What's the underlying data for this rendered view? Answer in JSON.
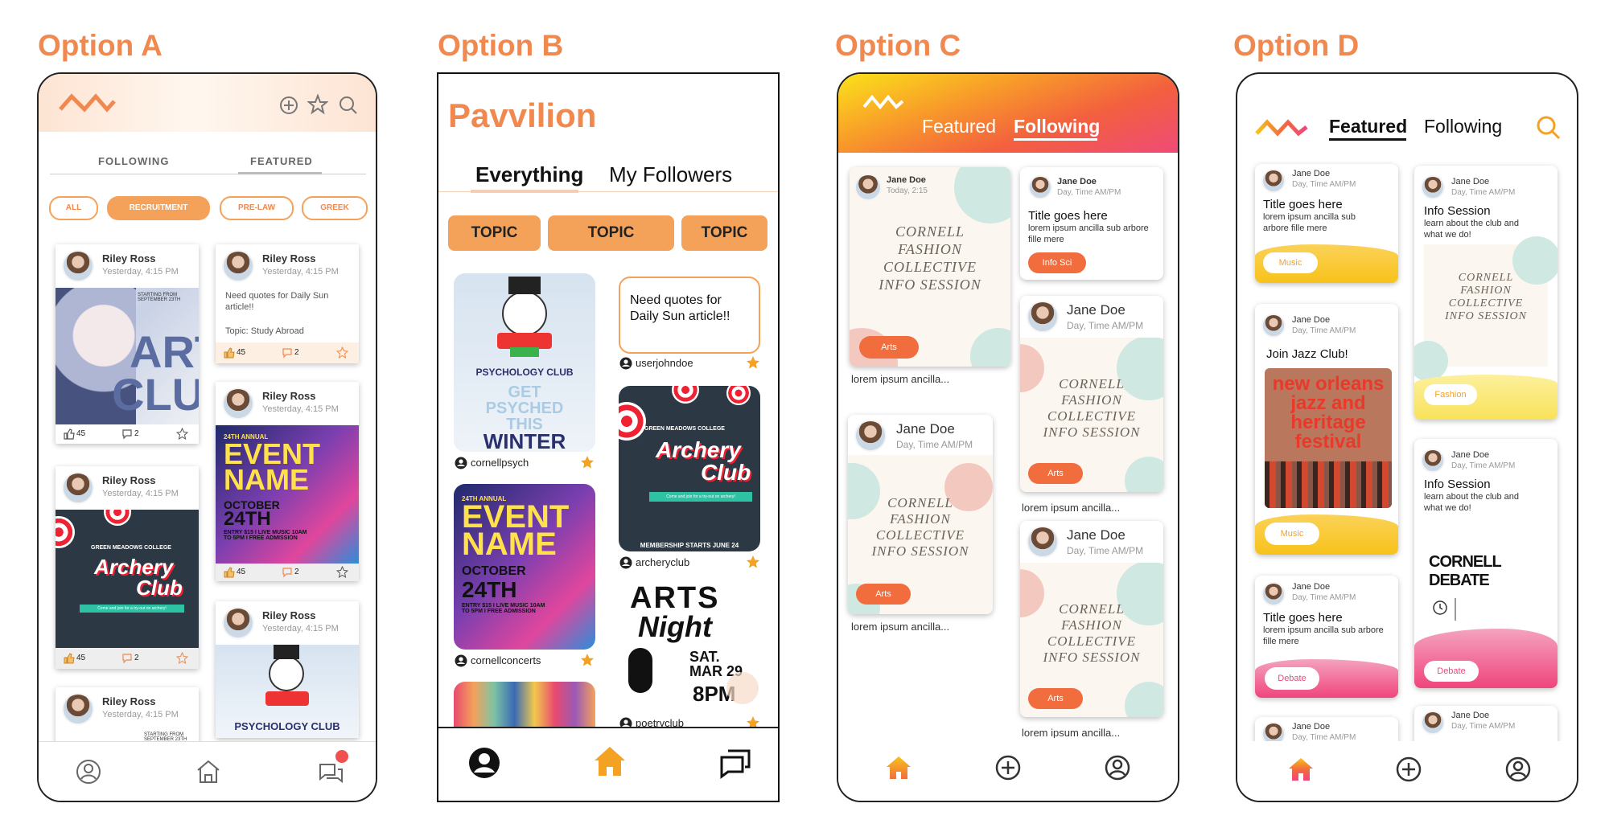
{
  "titles": [
    "Option A",
    "Option B",
    "Option C",
    "Option D"
  ],
  "a": {
    "tabs": [
      "FOLLOWING",
      "FEATURED"
    ],
    "filters": [
      "ALL",
      "RECRUITMENT",
      "PRE-LAW",
      "GREEK"
    ],
    "user": "Riley Ross",
    "time": "Yesterday, 4:15 PM",
    "post_text": "Need quotes for Daily Sun article!!",
    "topic": "Topic: Study Abroad",
    "likes": "45",
    "comments": "2",
    "art_club_line1": "ART",
    "art_club_line2": "CLUB",
    "art_starting": "STARTING FROM SEPTEMBER 23TH",
    "event_annual": "24TH ANNUAL",
    "event_name1": "EVENT",
    "event_name2": "NAME",
    "event_date1": "OCTOBER",
    "event_date2": "24TH",
    "event_info": "ENTRY $15 I LIVE MUSIC 10AM TO 5PM I FREE ADMISSION",
    "archery_school": "GREEN MEADOWS COLLEGE",
    "archery1": "Archery",
    "archery2": "Club",
    "archery_bar": "Come and join for a try-out on archery!",
    "psych_club": "PSYCHOLOGY CLUB"
  },
  "b": {
    "app_title": "Pavvilion",
    "tabs": [
      "Everything",
      "My Followers"
    ],
    "topics": [
      "TOPIC",
      "TOPIC",
      "TOPIC"
    ],
    "psych_club": "PSYCHOLOGY CLUB",
    "get": "GET",
    "psyched": "PSYCHED",
    "this": "THIS",
    "winter": "WINTER",
    "u1": "cornellpsych",
    "quote": "Need quotes for Daily Sun article!!",
    "u2": "userjohndoe",
    "u3": "archeryclub",
    "membership": "MEMBERSHIP STARTS JUNE 24",
    "u4": "cornellconcerts",
    "arts1": "ARTS",
    "arts2": "Night",
    "arts_date1": "SAT. MAR 29",
    "arts_date2": "8PM",
    "u5": "poetryclub"
  },
  "c": {
    "tabs": [
      "Featured",
      "Following"
    ],
    "n1": "Jane Doe",
    "t1": "Today, 2:15",
    "n": "Jane Doe",
    "t": "Day, Time AM/PM",
    "poster_line1": "CORNELL",
    "poster_line2": "FASHION",
    "poster_line3": "COLLECTIVE",
    "poster_line4": "INFO SESSION",
    "arts": "Arts",
    "lorem": "lorem ipsum ancilla...",
    "title_here": "Title goes here",
    "body": "lorem ipsum ancilla sub arbore fille mere",
    "info_sci": "Info Sci"
  },
  "d": {
    "tabs": [
      "Featured",
      "Following"
    ],
    "name": "Jane Doe",
    "time": "Day, Time AM/PM",
    "title_here": "Title goes here",
    "body": "lorem ipsum ancilla sub arbore fille mere",
    "music": "Music",
    "info_session": "Info Session",
    "info_body": "learn about the club and what we do!",
    "fashion": "Fashion",
    "jazz_title": "Join Jazz Club!",
    "jazz1": "new orleans",
    "jazz2": "jazz and",
    "jazz3": "heritage",
    "jazz4": "festival",
    "debate_title": "CORNELL DEBATE",
    "debate": "Debate",
    "cornell1": "CORNELL",
    "cornell2": "FASHION",
    "cornell3": "COLLECTIVE",
    "cornell4": "INFO SESSION"
  },
  "colors": {
    "accent": "#f0894f",
    "orange": "#f4a25a",
    "red": "#f26d3d",
    "pink": "#f0457c",
    "yellow": "#f8c21a"
  },
  "icons": [
    "logo-icon",
    "plus-icon",
    "star-icon",
    "search-icon",
    "profile-icon",
    "home-icon",
    "chat-icon",
    "thumbs-up-icon",
    "comment-icon"
  ]
}
